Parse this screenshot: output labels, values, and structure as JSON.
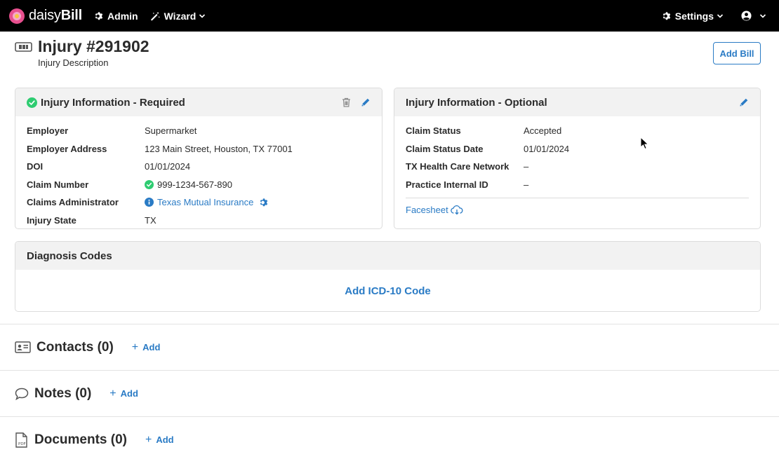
{
  "nav": {
    "brand_light": "daisy",
    "brand_bold": "Bill",
    "admin": "Admin",
    "wizard": "Wizard",
    "settings": "Settings"
  },
  "header": {
    "title": "Injury #291902",
    "subtitle": "Injury Description",
    "add_bill": "Add Bill"
  },
  "required": {
    "title": "Injury Information - Required",
    "rows": [
      {
        "label": "Employer",
        "value": "Supermarket"
      },
      {
        "label": "Employer Address",
        "value": "123 Main Street, Houston, TX 77001"
      },
      {
        "label": "DOI",
        "value": "01/01/2024"
      },
      {
        "label": "Claim Number",
        "value": "999-1234-567-890"
      },
      {
        "label": "Claims Administrator",
        "value": "Texas Mutual Insurance"
      },
      {
        "label": "Injury State",
        "value": "TX"
      }
    ]
  },
  "optional": {
    "title": "Injury Information - Optional",
    "rows": [
      {
        "label": "Claim Status",
        "value": "Accepted"
      },
      {
        "label": "Claim Status Date",
        "value": "01/01/2024"
      },
      {
        "label": "TX Health Care Network",
        "value": "–"
      },
      {
        "label": "Practice Internal ID",
        "value": "–"
      }
    ],
    "facesheet": "Facesheet"
  },
  "diagnosis": {
    "title": "Diagnosis Codes",
    "add_link": "Add ICD-10 Code"
  },
  "sections": {
    "contacts": {
      "title": "Contacts (0)",
      "add": "Add"
    },
    "notes": {
      "title": "Notes (0)",
      "add": "Add"
    },
    "documents": {
      "title": "Documents (0)",
      "add": "Add"
    }
  },
  "colors": {
    "accent": "#2a7bc5",
    "success": "#2ecc71",
    "nav_bg": "#000000"
  }
}
